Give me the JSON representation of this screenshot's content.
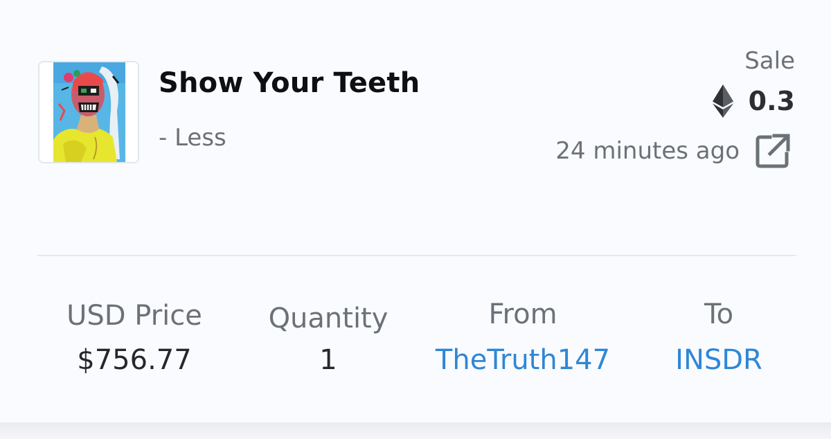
{
  "nft": {
    "title": "Show Your Teeth",
    "artist": "- Less"
  },
  "event": {
    "type": "Sale",
    "price_eth": "0.3",
    "currency_icon": "ethereum-icon",
    "time_ago": "24 minutes ago",
    "link_icon": "external-link-icon"
  },
  "stats": {
    "usd_price_label": "USD Price",
    "usd_price_value": "$756.77",
    "quantity_label": "Quantity",
    "quantity_value": "1",
    "from_label": "From",
    "from_value": "TheTruth147",
    "to_label": "To",
    "to_value": "INSDR"
  },
  "colors": {
    "link": "#2f86d6",
    "muted": "#6b7178",
    "title": "#0d0f14"
  }
}
